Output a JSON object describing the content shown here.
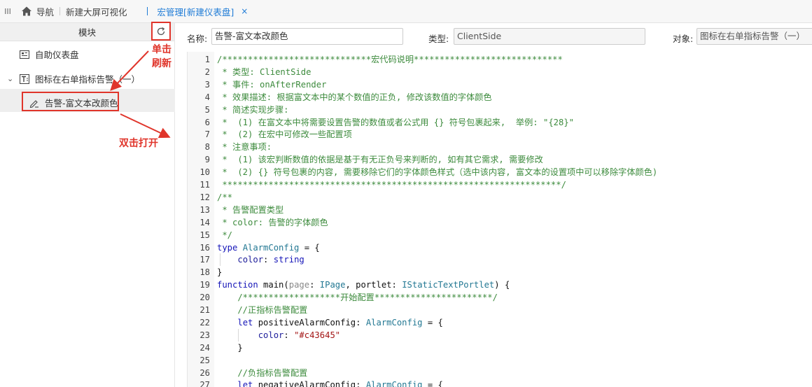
{
  "topbar": {
    "nav_label": "导航",
    "tabs": [
      {
        "label": "新建大屏可视化"
      },
      {
        "label": "宏管理[新建仪表盘]"
      }
    ],
    "close_glyph": "×"
  },
  "sidebar": {
    "header_label": "模块",
    "items": [
      {
        "label": "自助仪表盘",
        "icon": "dashboard-icon"
      },
      {
        "label": "图标在右单指标告警（一）",
        "icon": "text-component-icon",
        "expand": "⌄"
      },
      {
        "label": "告警-富文本改颜色",
        "icon": "macro-pen-icon"
      }
    ],
    "annotations": {
      "refresh": "单击刷新",
      "open": "双击打开"
    }
  },
  "form": {
    "name_label": "名称:",
    "name_value": "告警-富文本改颜色",
    "type_label": "类型:",
    "type_value": "ClientSide",
    "object_label": "对象:",
    "object_value": "图标在右单指标告警（一）"
  },
  "colors": {
    "accent": "#1e7bd6",
    "annotation_red": "#e0352b",
    "comment_green": "#3d8b3d",
    "keyword_blue": "#1515b8",
    "type_teal": "#237893",
    "string_red": "#a31515"
  },
  "code_lines": [
    {
      "n": "1",
      "tokens": [
        {
          "t": "/*****************************宏代码说明*****************************",
          "c": "comment"
        }
      ]
    },
    {
      "n": "2",
      "tokens": [
        {
          "t": " * 类型: ClientSide",
          "c": "comment"
        }
      ]
    },
    {
      "n": "3",
      "tokens": [
        {
          "t": " * 事件: onAfterRender",
          "c": "comment"
        }
      ]
    },
    {
      "n": "4",
      "tokens": [
        {
          "t": " * 效果描述: 根据富文本中的某个数值的正负, 修改该数值的字体颜色",
          "c": "comment"
        }
      ]
    },
    {
      "n": "5",
      "tokens": [
        {
          "t": " * 简述实现步骤:",
          "c": "comment"
        }
      ]
    },
    {
      "n": "6",
      "tokens": [
        {
          "t": " *  (1) 在富文本中将需要设置告警的数值或者公式用 {} 符号包裹起来,  举例: \"{28}\"",
          "c": "comment"
        }
      ]
    },
    {
      "n": "7",
      "tokens": [
        {
          "t": " *  (2) 在宏中可修改一些配置项",
          "c": "comment"
        }
      ]
    },
    {
      "n": "8",
      "tokens": [
        {
          "t": " * 注意事项:",
          "c": "comment"
        }
      ]
    },
    {
      "n": "9",
      "tokens": [
        {
          "t": " *  (1) 该宏判断数值的依据是基于有无正负号来判断的, 如有其它需求, 需要修改",
          "c": "comment"
        }
      ]
    },
    {
      "n": "10",
      "tokens": [
        {
          "t": " *  (2) {} 符号包裹的内容, 需要移除它们的字体颜色样式（选中该内容, 富文本的设置项中可以移除字体颜色)",
          "c": "comment"
        }
      ]
    },
    {
      "n": "11",
      "tokens": [
        {
          "t": " ******************************************************************/",
          "c": "comment"
        }
      ]
    },
    {
      "n": "12",
      "tokens": [
        {
          "t": "/**",
          "c": "comment"
        }
      ]
    },
    {
      "n": "13",
      "tokens": [
        {
          "t": " * 告警配置类型",
          "c": "comment"
        }
      ]
    },
    {
      "n": "14",
      "tokens": [
        {
          "t": " * color: 告警的字体颜色",
          "c": "comment"
        }
      ]
    },
    {
      "n": "15",
      "tokens": [
        {
          "t": " */",
          "c": "comment"
        }
      ]
    },
    {
      "n": "16",
      "tokens": [
        {
          "t": "type ",
          "c": "kw"
        },
        {
          "t": "AlarmConfig",
          "c": "type"
        },
        {
          "t": " = {",
          "c": "plain"
        }
      ]
    },
    {
      "n": "17",
      "tokens": [
        {
          "t": "    ",
          "c": "plain"
        },
        {
          "t": "color",
          "c": "prop"
        },
        {
          "t": ": ",
          "c": "plain"
        },
        {
          "t": "string",
          "c": "kw"
        }
      ]
    },
    {
      "n": "18",
      "tokens": [
        {
          "t": "}",
          "c": "plain"
        }
      ]
    },
    {
      "n": "19",
      "tokens": [
        {
          "t": "function ",
          "c": "kw"
        },
        {
          "t": "main(",
          "c": "plain"
        },
        {
          "t": "page",
          "c": "param"
        },
        {
          "t": ": ",
          "c": "plain"
        },
        {
          "t": "IPage",
          "c": "type"
        },
        {
          "t": ", portlet: ",
          "c": "plain"
        },
        {
          "t": "IStaticTextPortlet",
          "c": "type"
        },
        {
          "t": ") {",
          "c": "plain"
        }
      ]
    },
    {
      "n": "20",
      "tokens": [
        {
          "t": "    /*******************开始配置***********************/",
          "c": "comment"
        }
      ]
    },
    {
      "n": "21",
      "tokens": [
        {
          "t": "    //正指标告警配置",
          "c": "comment"
        }
      ]
    },
    {
      "n": "22",
      "tokens": [
        {
          "t": "    ",
          "c": "plain"
        },
        {
          "t": "let ",
          "c": "kw"
        },
        {
          "t": "positiveAlarmConfig: ",
          "c": "plain"
        },
        {
          "t": "AlarmConfig",
          "c": "type"
        },
        {
          "t": " = {",
          "c": "plain"
        }
      ]
    },
    {
      "n": "23",
      "tokens": [
        {
          "t": "        ",
          "c": "plain"
        },
        {
          "t": "color",
          "c": "prop"
        },
        {
          "t": ": ",
          "c": "plain"
        },
        {
          "t": "\"#c43645\"",
          "c": "str"
        }
      ]
    },
    {
      "n": "24",
      "tokens": [
        {
          "t": "    }",
          "c": "plain"
        }
      ]
    },
    {
      "n": "25",
      "tokens": [
        {
          "t": "",
          "c": "plain"
        }
      ]
    },
    {
      "n": "26",
      "tokens": [
        {
          "t": "    //负指标告警配置",
          "c": "comment"
        }
      ]
    },
    {
      "n": "27",
      "tokens": [
        {
          "t": "    ",
          "c": "plain"
        },
        {
          "t": "let ",
          "c": "kw"
        },
        {
          "t": "negativeAlarmConfig: ",
          "c": "plain"
        },
        {
          "t": "AlarmConfig",
          "c": "type"
        },
        {
          "t": " = {",
          "c": "plain"
        }
      ]
    }
  ]
}
